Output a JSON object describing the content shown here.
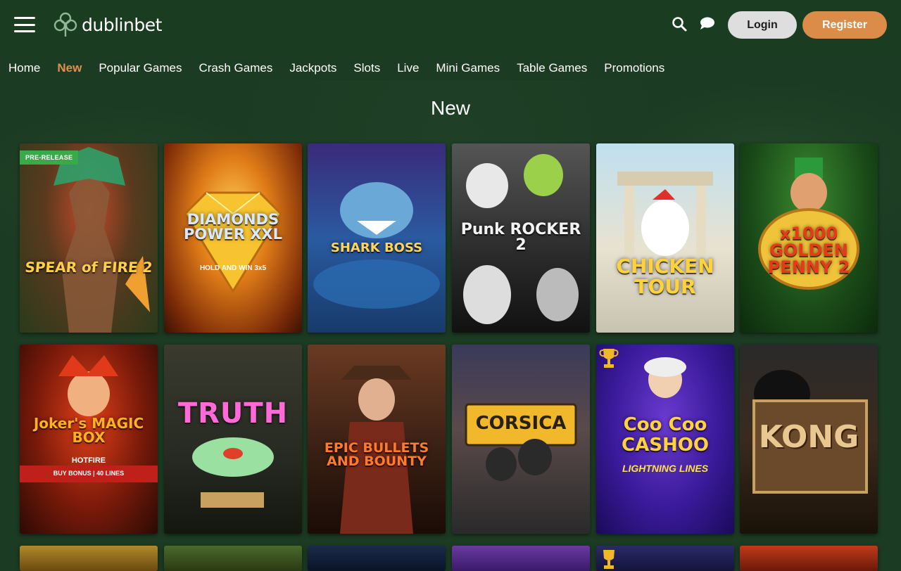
{
  "header": {
    "brand": "dublinbet",
    "login_label": "Login",
    "register_label": "Register"
  },
  "nav": [
    {
      "label": "Home",
      "active": false
    },
    {
      "label": "New",
      "active": true
    },
    {
      "label": "Popular Games",
      "active": false
    },
    {
      "label": "Crash Games",
      "active": false
    },
    {
      "label": "Jackpots",
      "active": false
    },
    {
      "label": "Slots",
      "active": false
    },
    {
      "label": "Live",
      "active": false
    },
    {
      "label": "Mini Games",
      "active": false
    },
    {
      "label": "Table Games",
      "active": false
    },
    {
      "label": "Promotions",
      "active": false
    }
  ],
  "page_title": "New",
  "colors": {
    "background": "#1c3b23",
    "header": "#1a3d22",
    "accent": "#e1904c",
    "register": "#db8c48",
    "login": "#dedede",
    "badge": "#3aa94a"
  },
  "games": [
    {
      "title": "SPEAR of FIRE 2",
      "badge": "PRE-RELEASE"
    },
    {
      "title": "DIAMONDS POWER XXL",
      "sub": "HOLD AND WIN 3x5"
    },
    {
      "title": "SHARK BOSS"
    },
    {
      "title": "Punk ROCKER 2"
    },
    {
      "title": "CHICKEN TOUR"
    },
    {
      "title": "x1000 GOLDEN PENNY 2"
    },
    {
      "title": "Joker's MAGIC BOX",
      "sub": "HOTFIRE",
      "sub2": "BUY BONUS | 40 LINES"
    },
    {
      "title": "TRUTH"
    },
    {
      "title": "EPIC BULLETS AND BOUNTY"
    },
    {
      "title": "CORSICA"
    },
    {
      "title": "Coo Coo CASHOO",
      "sub": "LIGHTNING LINES",
      "trophy": true
    },
    {
      "title": "KONG"
    }
  ]
}
